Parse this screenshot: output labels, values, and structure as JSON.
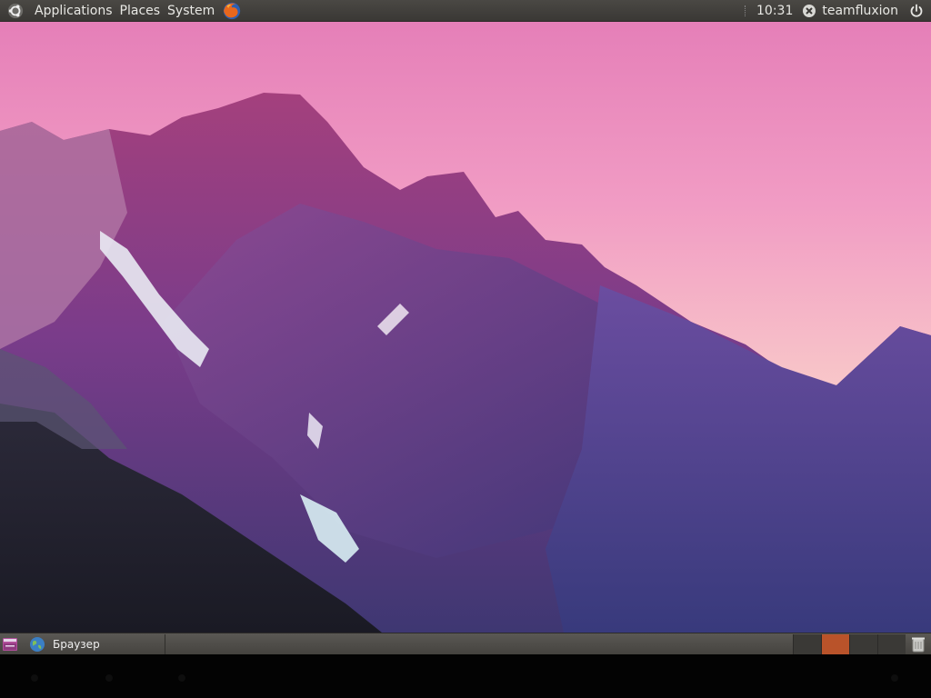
{
  "top_panel": {
    "menus": [
      "Applications",
      "Places",
      "System"
    ],
    "clock": "10:31",
    "user": "teamfluxion"
  },
  "bottom_panel": {
    "task": {
      "label": "Браузер"
    },
    "workspaces": [
      {
        "active": false
      },
      {
        "active": true
      },
      {
        "active": false
      },
      {
        "active": false
      }
    ]
  },
  "colors": {
    "accent": "#b9532a",
    "panel": "#3d3b38"
  }
}
